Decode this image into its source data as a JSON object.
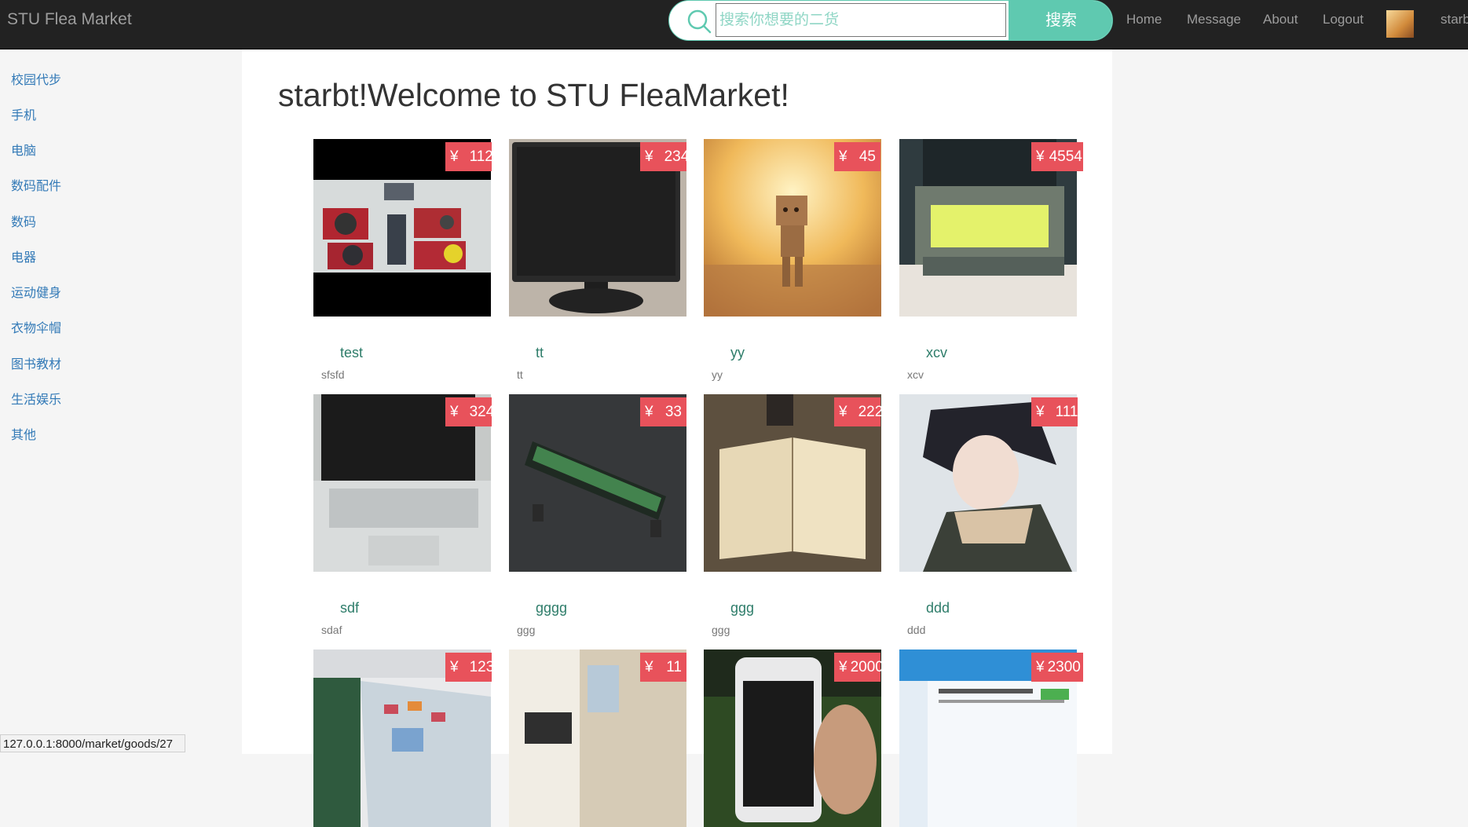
{
  "brand": "STU Flea Market",
  "search": {
    "placeholder": "搜索你想要的二货",
    "button_label": "搜索"
  },
  "nav": {
    "home": "Home",
    "message": "Message",
    "about": "About",
    "logout": "Logout",
    "username": "starbt"
  },
  "sidebar": {
    "items": [
      {
        "label": "校园代步"
      },
      {
        "label": "手机"
      },
      {
        "label": "电脑"
      },
      {
        "label": "数码配件"
      },
      {
        "label": "数码"
      },
      {
        "label": "电器"
      },
      {
        "label": "运动健身"
      },
      {
        "label": "衣物伞帽"
      },
      {
        "label": "图书教材"
      },
      {
        "label": "生活娱乐"
      },
      {
        "label": "其他"
      }
    ]
  },
  "main": {
    "title": "starbt!Welcome to STU FleaMarket!"
  },
  "currency": "¥",
  "goods": [
    {
      "name": "test",
      "desc": "sfsfd",
      "price": "112"
    },
    {
      "name": "tt",
      "desc": "tt",
      "price": "234"
    },
    {
      "name": "yy",
      "desc": "yy",
      "price": "45"
    },
    {
      "name": "xcv",
      "desc": "xcv",
      "price": "4554"
    },
    {
      "name": "sdf",
      "desc": "sdaf",
      "price": "324"
    },
    {
      "name": "gggg",
      "desc": "ggg",
      "price": "33"
    },
    {
      "name": "ggg",
      "desc": "ggg",
      "price": "222"
    },
    {
      "name": "ddd",
      "desc": "ddd",
      "price": "111"
    },
    {
      "name": "",
      "desc": "",
      "price": "123"
    },
    {
      "name": "",
      "desc": "",
      "price": "11"
    },
    {
      "name": "",
      "desc": "",
      "price": "2000"
    },
    {
      "name": "",
      "desc": "",
      "price": "2300"
    }
  ],
  "status_bar": {
    "url": "127.0.0.1:8000/market/goods/27"
  }
}
